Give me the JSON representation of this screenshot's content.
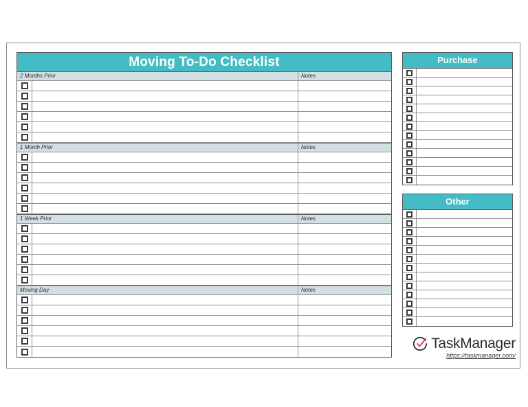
{
  "document": {
    "title": "Moving To-Do Checklist"
  },
  "checklist": {
    "title": "Moving To-Do Checklist",
    "notes_label": "Notes",
    "sections": [
      {
        "label": "2 Months Prior",
        "notes_label": "Notes",
        "row_count": 6
      },
      {
        "label": "1 Month Prior",
        "notes_label": "Notes",
        "row_count": 6
      },
      {
        "label": "1 Week Prior",
        "notes_label": "Notes",
        "row_count": 6
      },
      {
        "label": "Moving Day",
        "notes_label": "Notes",
        "row_count": 6
      }
    ]
  },
  "side_panels": [
    {
      "title": "Purchase",
      "row_count": 13
    },
    {
      "title": "Other",
      "row_count": 13
    }
  ],
  "logo": {
    "icon": "circle-check-icon",
    "name": "TaskManager",
    "url": "https://taskmanager.com/"
  },
  "colors": {
    "accent_teal": "#45BCC5",
    "section_band": "#D3E0E3",
    "border_dark": "#5b5b5b",
    "border_light": "#8f8f8f",
    "logo_check": "#E8246C",
    "logo_text": "#2d2d2d",
    "page_background": "#ffffff"
  }
}
